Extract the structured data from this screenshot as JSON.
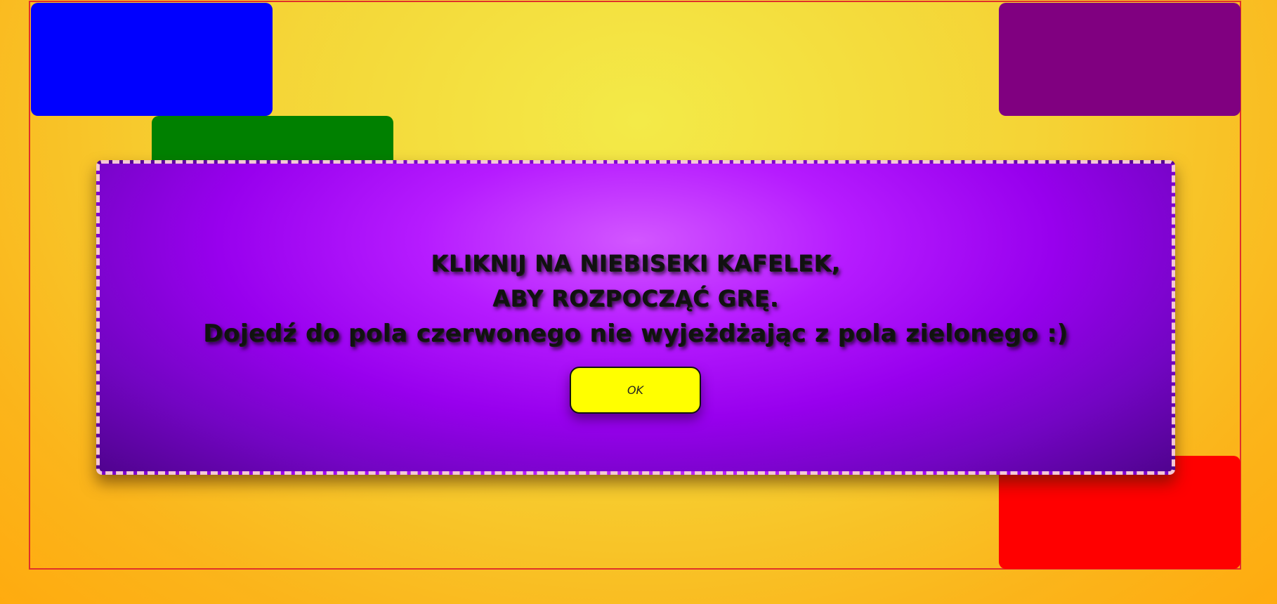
{
  "colors": {
    "background": "#f5d335",
    "board_border": "#e0302a",
    "tile_blue": "#0000ff",
    "tile_green": "#008000",
    "tile_purple": "#800080",
    "tile_red": "#ff0000",
    "modal_center": "#d256ff",
    "modal_edge": "#50038f",
    "modal_border": "#f4c7d6",
    "ok_button": "#ffff00"
  },
  "modal": {
    "line1": "KLIKNIJ NA NIEBISEKI KAFELEK,",
    "line2": "ABY ROZPOCZĄĆ GRĘ.",
    "line3": "Dojedź do pola czerwonego nie wyjeżdżając z pola zielonego :)",
    "ok_label": "OK"
  }
}
